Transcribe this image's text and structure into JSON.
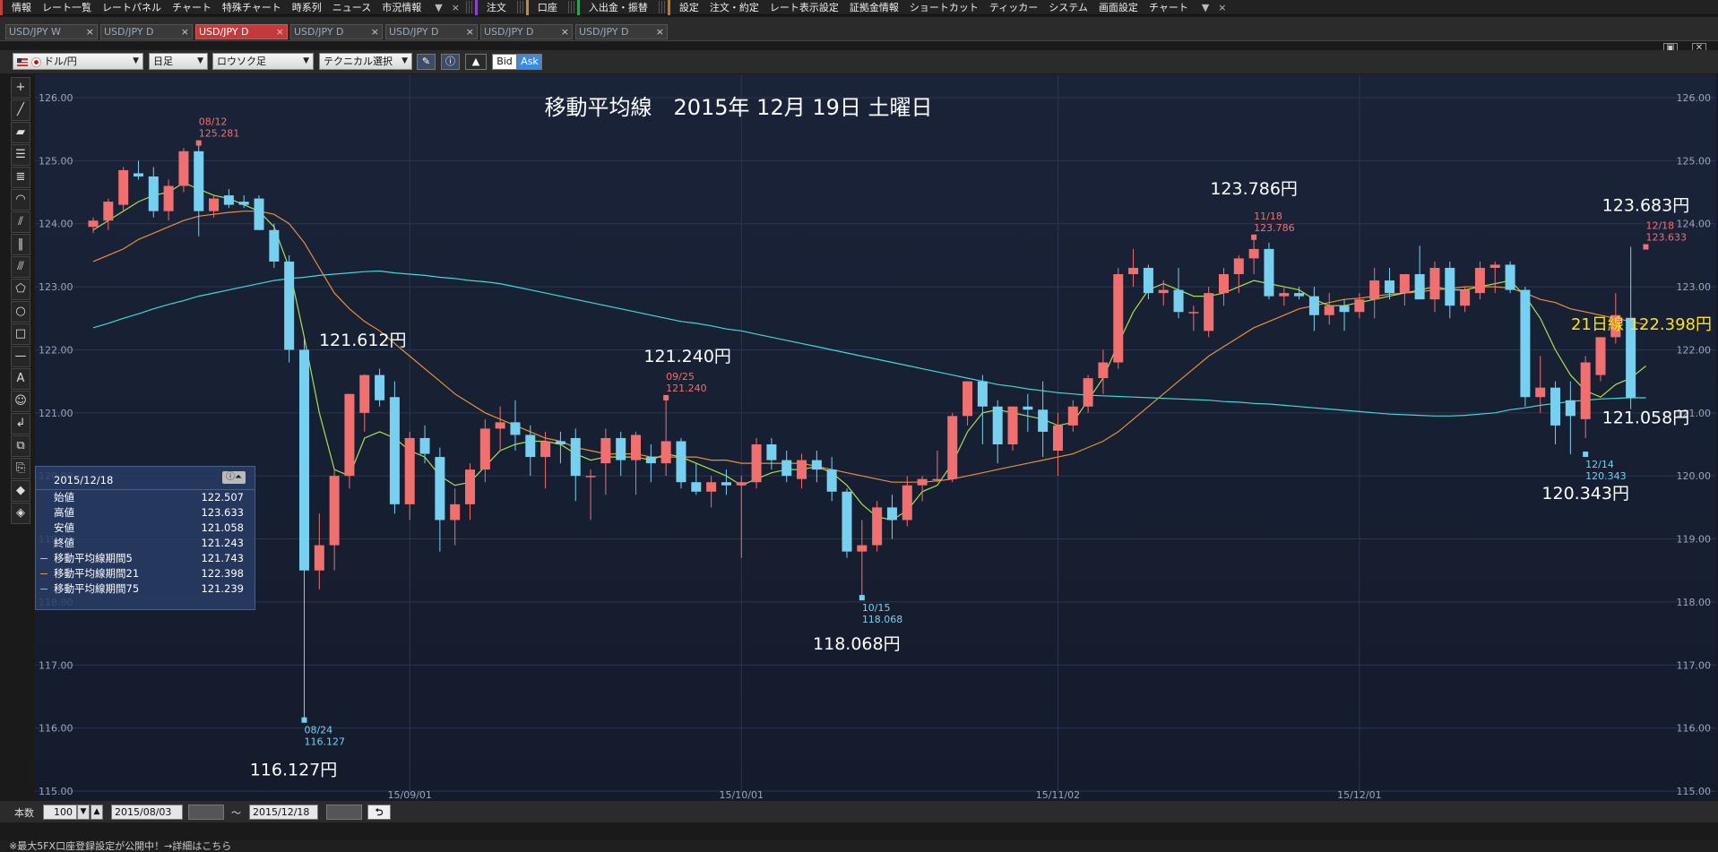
{
  "menubar": {
    "group1": [
      "情報",
      "レート一覧",
      "レートパネル",
      "チャート",
      "特殊チャート",
      "時系列",
      "ニュース",
      "市況情報"
    ],
    "group2": [
      "注文"
    ],
    "group3": [
      "口座"
    ],
    "group4": [
      "入出金・振替"
    ],
    "group5": [
      "設定",
      "注文・約定",
      "レート表示設定",
      "証拠金情報",
      "ショートカット",
      "ティッカー",
      "システム",
      "画面設定",
      "チャート"
    ],
    "more": "▼",
    "close": "×"
  },
  "tabs": [
    {
      "label": "USD/JPY W",
      "active": false
    },
    {
      "label": "USD/JPY D",
      "active": false
    },
    {
      "label": "USD/JPY D",
      "active": true
    },
    {
      "label": "USD/JPY D",
      "active": false
    },
    {
      "label": "USD/JPY D",
      "active": false
    },
    {
      "label": "USD/JPY D",
      "active": false
    },
    {
      "label": "USD/JPY D",
      "active": false
    }
  ],
  "tab_close": "×",
  "toolbar": {
    "pair": "ドル/円",
    "period": "日足",
    "chart_style": "ロウソク足",
    "technical": "テクニカル選択",
    "bid": "Bid",
    "ask": "Ask"
  },
  "chart_data": {
    "type": "candlestick",
    "title": "移動平均線　2015年 12月 19日 土曜日",
    "y_ticks": [
      "126.00",
      "125.00",
      "124.00",
      "123.00",
      "122.00",
      "121.00",
      "120.00",
      "119.00",
      "118.00",
      "117.00",
      "116.00",
      "115.00"
    ],
    "ylim": [
      115.0,
      126.0
    ],
    "x_ticks": [
      "15/09/01",
      "15/10/01",
      "15/11/02",
      "15/12/01"
    ],
    "bullish_color": "#f07070",
    "bearish_color": "#78d0f0",
    "ma_colors": {
      "ma5": "#a8e050",
      "ma21": "#e8903a",
      "ma75": "#40d8d8"
    },
    "candles": [
      {
        "o": 123.95,
        "h": 124.1,
        "l": 123.85,
        "c": 124.05
      },
      {
        "o": 124.05,
        "h": 124.4,
        "l": 123.9,
        "c": 124.35
      },
      {
        "o": 124.3,
        "h": 124.9,
        "l": 124.2,
        "c": 124.85
      },
      {
        "o": 124.8,
        "h": 125.0,
        "l": 124.7,
        "c": 124.75
      },
      {
        "o": 124.75,
        "h": 124.9,
        "l": 124.1,
        "c": 124.2
      },
      {
        "o": 124.2,
        "h": 124.7,
        "l": 124.05,
        "c": 124.6
      },
      {
        "o": 124.6,
        "h": 125.2,
        "l": 124.5,
        "c": 125.15
      },
      {
        "o": 125.15,
        "h": 125.28,
        "l": 123.8,
        "c": 124.2
      },
      {
        "o": 124.2,
        "h": 124.45,
        "l": 124.1,
        "c": 124.4
      },
      {
        "o": 124.45,
        "h": 124.55,
        "l": 124.25,
        "c": 124.3
      },
      {
        "o": 124.35,
        "h": 124.45,
        "l": 124.25,
        "c": 124.3
      },
      {
        "o": 124.4,
        "h": 124.45,
        "l": 123.9,
        "c": 123.9
      },
      {
        "o": 123.9,
        "h": 124.0,
        "l": 123.3,
        "c": 123.4
      },
      {
        "o": 123.4,
        "h": 123.5,
        "l": 121.8,
        "c": 122.0
      },
      {
        "o": 122.0,
        "h": 122.2,
        "l": 116.127,
        "c": 118.5
      },
      {
        "o": 118.5,
        "h": 119.4,
        "l": 118.2,
        "c": 118.9
      },
      {
        "o": 118.9,
        "h": 120.1,
        "l": 118.5,
        "c": 120.0
      },
      {
        "o": 120.0,
        "h": 121.3,
        "l": 119.8,
        "c": 121.3
      },
      {
        "o": 121.0,
        "h": 121.612,
        "l": 120.7,
        "c": 121.6
      },
      {
        "o": 121.6,
        "h": 121.7,
        "l": 121.1,
        "c": 121.2
      },
      {
        "o": 121.25,
        "h": 121.5,
        "l": 119.4,
        "c": 119.55
      },
      {
        "o": 119.55,
        "h": 120.7,
        "l": 119.3,
        "c": 120.6
      },
      {
        "o": 120.6,
        "h": 120.8,
        "l": 120.2,
        "c": 120.35
      },
      {
        "o": 120.3,
        "h": 120.45,
        "l": 118.8,
        "c": 119.3
      },
      {
        "o": 119.3,
        "h": 119.8,
        "l": 118.9,
        "c": 119.55
      },
      {
        "o": 119.55,
        "h": 120.2,
        "l": 119.3,
        "c": 120.1
      },
      {
        "o": 120.1,
        "h": 120.9,
        "l": 119.9,
        "c": 120.75
      },
      {
        "o": 120.75,
        "h": 121.1,
        "l": 120.4,
        "c": 120.85
      },
      {
        "o": 120.85,
        "h": 121.2,
        "l": 120.4,
        "c": 120.65
      },
      {
        "o": 120.65,
        "h": 120.8,
        "l": 120.0,
        "c": 120.3
      },
      {
        "o": 120.3,
        "h": 120.7,
        "l": 119.8,
        "c": 120.55
      },
      {
        "o": 120.55,
        "h": 120.7,
        "l": 120.2,
        "c": 120.5
      },
      {
        "o": 120.6,
        "h": 120.75,
        "l": 119.6,
        "c": 120.0
      },
      {
        "o": 120.0,
        "h": 120.1,
        "l": 119.3,
        "c": 120.0
      },
      {
        "o": 120.2,
        "h": 120.75,
        "l": 119.7,
        "c": 120.6
      },
      {
        "o": 120.6,
        "h": 120.7,
        "l": 120.0,
        "c": 120.25
      },
      {
        "o": 120.25,
        "h": 120.7,
        "l": 119.7,
        "c": 120.65
      },
      {
        "o": 120.3,
        "h": 120.5,
        "l": 119.9,
        "c": 120.2
      },
      {
        "o": 120.2,
        "h": 121.24,
        "l": 120.0,
        "c": 120.55
      },
      {
        "o": 120.55,
        "h": 120.6,
        "l": 119.8,
        "c": 119.9
      },
      {
        "o": 119.9,
        "h": 120.2,
        "l": 119.7,
        "c": 119.75
      },
      {
        "o": 119.75,
        "h": 120.0,
        "l": 119.5,
        "c": 119.9
      },
      {
        "o": 119.9,
        "h": 120.1,
        "l": 119.7,
        "c": 119.85
      },
      {
        "o": 119.85,
        "h": 120.0,
        "l": 118.7,
        "c": 119.9
      },
      {
        "o": 119.9,
        "h": 120.6,
        "l": 119.8,
        "c": 120.5
      },
      {
        "o": 120.5,
        "h": 120.6,
        "l": 120.1,
        "c": 120.25
      },
      {
        "o": 120.25,
        "h": 120.4,
        "l": 119.9,
        "c": 120.0
      },
      {
        "o": 119.95,
        "h": 120.35,
        "l": 119.8,
        "c": 120.25
      },
      {
        "o": 120.25,
        "h": 120.4,
        "l": 119.9,
        "c": 120.1
      },
      {
        "o": 120.1,
        "h": 120.3,
        "l": 119.6,
        "c": 119.75
      },
      {
        "o": 119.75,
        "h": 119.8,
        "l": 118.7,
        "c": 118.8
      },
      {
        "o": 118.8,
        "h": 119.3,
        "l": 118.068,
        "c": 118.9
      },
      {
        "o": 118.9,
        "h": 119.6,
        "l": 118.8,
        "c": 119.5
      },
      {
        "o": 119.5,
        "h": 119.7,
        "l": 119.0,
        "c": 119.3
      },
      {
        "o": 119.3,
        "h": 120.0,
        "l": 119.2,
        "c": 119.85
      },
      {
        "o": 119.85,
        "h": 120.0,
        "l": 119.6,
        "c": 119.95
      },
      {
        "o": 119.95,
        "h": 120.4,
        "l": 119.9,
        "c": 119.95
      },
      {
        "o": 119.95,
        "h": 121.0,
        "l": 119.9,
        "c": 120.95
      },
      {
        "o": 120.95,
        "h": 121.5,
        "l": 120.8,
        "c": 121.5
      },
      {
        "o": 121.5,
        "h": 121.6,
        "l": 120.5,
        "c": 121.1
      },
      {
        "o": 121.1,
        "h": 121.2,
        "l": 120.2,
        "c": 120.5
      },
      {
        "o": 120.5,
        "h": 121.1,
        "l": 120.4,
        "c": 121.1
      },
      {
        "o": 121.1,
        "h": 121.3,
        "l": 120.7,
        "c": 121.05
      },
      {
        "o": 121.05,
        "h": 121.5,
        "l": 120.3,
        "c": 120.7
      },
      {
        "o": 120.4,
        "h": 121.0,
        "l": 120.0,
        "c": 120.8
      },
      {
        "o": 120.8,
        "h": 121.2,
        "l": 120.7,
        "c": 121.1
      },
      {
        "o": 121.1,
        "h": 121.6,
        "l": 121.0,
        "c": 121.55
      },
      {
        "o": 121.55,
        "h": 122.0,
        "l": 121.3,
        "c": 121.8
      },
      {
        "o": 121.8,
        "h": 123.3,
        "l": 121.7,
        "c": 123.2
      },
      {
        "o": 123.2,
        "h": 123.6,
        "l": 123.0,
        "c": 123.3
      },
      {
        "o": 123.3,
        "h": 123.35,
        "l": 122.8,
        "c": 122.9
      },
      {
        "o": 122.9,
        "h": 123.1,
        "l": 122.7,
        "c": 122.95
      },
      {
        "o": 122.95,
        "h": 123.3,
        "l": 122.5,
        "c": 122.6
      },
      {
        "o": 122.6,
        "h": 122.7,
        "l": 122.3,
        "c": 122.6
      },
      {
        "o": 122.3,
        "h": 123.0,
        "l": 122.2,
        "c": 122.9
      },
      {
        "o": 122.9,
        "h": 123.3,
        "l": 122.7,
        "c": 123.2
      },
      {
        "o": 123.2,
        "h": 123.5,
        "l": 122.9,
        "c": 123.45
      },
      {
        "o": 123.45,
        "h": 123.786,
        "l": 123.2,
        "c": 123.6
      },
      {
        "o": 123.6,
        "h": 123.7,
        "l": 122.8,
        "c": 122.85
      },
      {
        "o": 122.85,
        "h": 123.0,
        "l": 122.7,
        "c": 122.9
      },
      {
        "o": 122.9,
        "h": 123.0,
        "l": 122.8,
        "c": 122.85
      },
      {
        "o": 122.85,
        "h": 123.0,
        "l": 122.3,
        "c": 122.55
      },
      {
        "o": 122.55,
        "h": 122.9,
        "l": 122.4,
        "c": 122.7
      },
      {
        "o": 122.7,
        "h": 122.8,
        "l": 122.3,
        "c": 122.6
      },
      {
        "o": 122.6,
        "h": 122.9,
        "l": 122.5,
        "c": 122.8
      },
      {
        "o": 122.8,
        "h": 123.3,
        "l": 122.5,
        "c": 123.1
      },
      {
        "o": 123.1,
        "h": 123.3,
        "l": 122.8,
        "c": 122.9
      },
      {
        "o": 122.9,
        "h": 123.2,
        "l": 122.7,
        "c": 123.2
      },
      {
        "o": 123.2,
        "h": 123.65,
        "l": 122.9,
        "c": 122.8
      },
      {
        "o": 122.8,
        "h": 123.4,
        "l": 122.6,
        "c": 123.3
      },
      {
        "o": 123.3,
        "h": 123.4,
        "l": 122.5,
        "c": 122.7
      },
      {
        "o": 122.7,
        "h": 123.0,
        "l": 122.6,
        "c": 122.95
      },
      {
        "o": 122.9,
        "h": 123.4,
        "l": 122.8,
        "c": 123.3
      },
      {
        "o": 123.3,
        "h": 123.4,
        "l": 122.9,
        "c": 123.35
      },
      {
        "o": 123.35,
        "h": 123.4,
        "l": 122.9,
        "c": 122.95
      },
      {
        "o": 122.95,
        "h": 123.0,
        "l": 121.1,
        "c": 121.25
      },
      {
        "o": 121.25,
        "h": 121.9,
        "l": 121.0,
        "c": 121.4
      },
      {
        "o": 121.4,
        "h": 121.5,
        "l": 120.5,
        "c": 120.8
      },
      {
        "o": 121.2,
        "h": 121.5,
        "l": 120.343,
        "c": 120.95
      },
      {
        "o": 120.9,
        "h": 121.9,
        "l": 120.6,
        "c": 121.8
      },
      {
        "o": 121.6,
        "h": 122.2,
        "l": 121.5,
        "c": 122.2
      },
      {
        "o": 122.2,
        "h": 122.9,
        "l": 122.1,
        "c": 122.55
      },
      {
        "o": 122.507,
        "h": 123.633,
        "l": 121.058,
        "c": 121.243
      }
    ],
    "ma5": [
      123.9,
      124.05,
      124.2,
      124.35,
      124.45,
      124.5,
      124.65,
      124.55,
      124.45,
      124.4,
      124.3,
      124.2,
      123.95,
      123.3,
      122.2,
      121.0,
      120.1,
      120.0,
      120.6,
      120.7,
      120.6,
      120.4,
      120.3,
      120.0,
      119.85,
      119.9,
      120.15,
      120.4,
      120.5,
      120.55,
      120.55,
      120.5,
      120.35,
      120.25,
      120.3,
      120.3,
      120.3,
      120.25,
      120.35,
      120.3,
      120.2,
      120.1,
      120.0,
      119.85,
      119.95,
      120.05,
      120.1,
      120.1,
      120.15,
      120.05,
      119.85,
      119.55,
      119.35,
      119.3,
      119.45,
      119.75,
      119.85,
      120.2,
      120.7,
      121.0,
      121.05,
      121.0,
      120.95,
      120.9,
      120.8,
      120.85,
      121.2,
      121.55,
      122.1,
      122.6,
      122.95,
      123.05,
      122.95,
      122.85,
      122.85,
      122.9,
      123.0,
      123.1,
      123.05,
      123.0,
      122.95,
      122.8,
      122.7,
      122.7,
      122.75,
      122.8,
      122.85,
      122.9,
      122.95,
      123.0,
      122.95,
      122.95,
      123.0,
      123.05,
      123.1,
      122.85,
      122.5,
      122.0,
      121.6,
      121.35,
      121.25,
      121.45,
      121.55,
      121.743
    ],
    "ma21": [
      123.4,
      123.5,
      123.6,
      123.75,
      123.85,
      123.95,
      124.05,
      124.12,
      124.15,
      124.18,
      124.2,
      124.2,
      124.15,
      124.0,
      123.7,
      123.3,
      122.9,
      122.65,
      122.45,
      122.3,
      122.1,
      121.9,
      121.7,
      121.5,
      121.3,
      121.15,
      121.0,
      120.9,
      120.8,
      120.7,
      120.6,
      120.55,
      120.45,
      120.4,
      120.35,
      120.35,
      120.35,
      120.3,
      120.3,
      120.3,
      120.3,
      120.25,
      120.25,
      120.2,
      120.2,
      120.2,
      120.2,
      120.2,
      120.15,
      120.1,
      120.05,
      120.0,
      119.95,
      119.9,
      119.9,
      119.9,
      119.92,
      119.95,
      120.0,
      120.05,
      120.1,
      120.15,
      120.2,
      120.25,
      120.3,
      120.35,
      120.45,
      120.55,
      120.7,
      120.9,
      121.1,
      121.3,
      121.5,
      121.7,
      121.9,
      122.05,
      122.2,
      122.35,
      122.45,
      122.55,
      122.65,
      122.7,
      122.75,
      122.8,
      122.82,
      122.85,
      122.88,
      122.9,
      122.92,
      122.95,
      122.97,
      123.0,
      123.0,
      123.0,
      122.98,
      122.9,
      122.8,
      122.75,
      122.65,
      122.6,
      122.55,
      122.5,
      122.45,
      122.398
    ],
    "ma75": [
      122.35,
      122.42,
      122.5,
      122.57,
      122.65,
      122.72,
      122.78,
      122.85,
      122.9,
      122.95,
      123.0,
      123.05,
      123.1,
      123.13,
      123.15,
      123.18,
      123.2,
      123.22,
      123.24,
      123.25,
      123.22,
      123.2,
      123.18,
      123.15,
      123.13,
      123.1,
      123.08,
      123.05,
      123.0,
      122.95,
      122.9,
      122.85,
      122.8,
      122.75,
      122.7,
      122.65,
      122.6,
      122.55,
      122.5,
      122.45,
      122.42,
      122.38,
      122.33,
      122.3,
      122.25,
      122.2,
      122.15,
      122.1,
      122.05,
      122.0,
      121.95,
      121.9,
      121.85,
      121.8,
      121.75,
      121.7,
      121.65,
      121.6,
      121.55,
      121.5,
      121.45,
      121.42,
      121.38,
      121.35,
      121.32,
      121.3,
      121.28,
      121.27,
      121.26,
      121.25,
      121.24,
      121.23,
      121.22,
      121.21,
      121.2,
      121.18,
      121.17,
      121.15,
      121.14,
      121.12,
      121.1,
      121.08,
      121.06,
      121.04,
      121.02,
      121.0,
      120.98,
      120.97,
      120.96,
      120.95,
      120.95,
      120.96,
      120.98,
      121.0,
      121.05,
      121.08,
      121.12,
      121.15,
      121.18,
      121.2,
      121.22,
      121.23,
      121.24,
      121.239
    ],
    "annotations": [
      {
        "text": "08/12",
        "text2": "125.281",
        "color": "#f07070",
        "i": 7,
        "v": 125.281,
        "pos": "above"
      },
      {
        "text": "08/24",
        "text2": "116.127",
        "color": "#78d0f0",
        "i": 14,
        "v": 116.127,
        "pos": "below"
      },
      {
        "text": "09/25",
        "text2": "121.240",
        "color": "#f07070",
        "i": 38,
        "v": 121.24,
        "pos": "above"
      },
      {
        "text": "10/15",
        "text2": "118.068",
        "color": "#78d0f0",
        "i": 51,
        "v": 118.068,
        "pos": "below"
      },
      {
        "text": "11/18",
        "text2": "123.786",
        "color": "#f07070",
        "i": 77,
        "v": 123.786,
        "pos": "above"
      },
      {
        "text": "12/14",
        "text2": "120.343",
        "color": "#78d0f0",
        "i": 99,
        "v": 120.343,
        "pos": "below"
      },
      {
        "text": "12/18",
        "text2": "123.633",
        "color": "#f07070",
        "i": 103,
        "v": 123.633,
        "pos": "above"
      }
    ],
    "big_labels": [
      {
        "text": "121.612円",
        "i": 18,
        "v": 121.612
      },
      {
        "text": "121.240円",
        "i": 38,
        "v": 121.24
      },
      {
        "text": "118.068円",
        "i": 51,
        "v": 118.068
      },
      {
        "text": "116.127円",
        "i": 14,
        "v": 116.127
      },
      {
        "text": "123.786円",
        "i": 77,
        "v": 123.786
      },
      {
        "text": "123.683円",
        "i": 103,
        "v": 123.633
      },
      {
        "text": "121.058円",
        "i": 103,
        "v": 121.058
      },
      {
        "text": "120.343円",
        "i": 99,
        "v": 120.343
      }
    ],
    "ma21_label": "21日線 122.398円"
  },
  "infobox": {
    "date": "2015/12/18",
    "rows": [
      {
        "label": "始値",
        "value": "122.507"
      },
      {
        "label": "高値",
        "value": "123.633"
      },
      {
        "label": "安値",
        "value": "121.058"
      },
      {
        "label": "終値",
        "value": "121.243"
      },
      {
        "label": "移動平均線期間5",
        "value": "121.743"
      },
      {
        "label": "移動平均線期間21",
        "value": "122.398"
      },
      {
        "label": "移動平均線期間75",
        "value": "121.239"
      }
    ]
  },
  "bottombar": {
    "count_label": "本数",
    "count_value": "100",
    "start_date": "2015/08/03",
    "tilde": "～",
    "end_date": "2015/12/18"
  },
  "statusbar": {
    "text": "※最大5FX口座登録設定が公開中！→詳細はこちら"
  }
}
